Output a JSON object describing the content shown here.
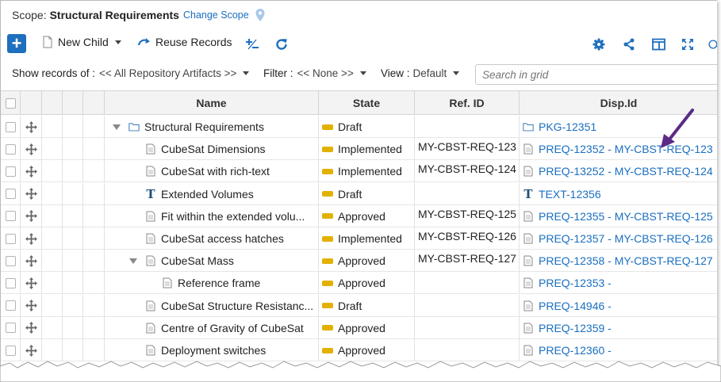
{
  "scope": {
    "label": "Scope:",
    "name": "Structural Requirements",
    "change": "Change Scope"
  },
  "toolbar": {
    "new_child": "New Child",
    "reuse": "Reuse Records",
    "icons": [
      "add-icon",
      "document-icon",
      "reuse-icon",
      "plus-minus-icon",
      "refresh-icon",
      "gear-icon",
      "share-icon",
      "columns-icon",
      "expand-icon"
    ]
  },
  "filterbar": {
    "show_label": "Show records of :",
    "show_value": "<< All Repository Artifacts >>",
    "filter_label": "Filter :",
    "filter_value": "<< None >>",
    "view_label": "View :",
    "view_value": "Default",
    "search_placeholder": "Search in grid"
  },
  "grid": {
    "columns": [
      "Name",
      "State",
      "Ref. ID",
      "Disp.Id"
    ],
    "rows": [
      {
        "name": "Structural Requirements",
        "icon": "folder",
        "indent": 0,
        "expander": true,
        "state": "Draft",
        "ref": "",
        "disp": "PKG-12351",
        "disp_icon": "folder"
      },
      {
        "name": "CubeSat Dimensions",
        "icon": "doc",
        "indent": 1,
        "expander": false,
        "state": "Implemented",
        "ref": "MY-CBST-REQ-123",
        "disp": "PREQ-12352 - MY-CBST-REQ-123",
        "disp_icon": "doc"
      },
      {
        "name": "CubeSat with rich-text",
        "icon": "doc",
        "indent": 1,
        "expander": false,
        "state": "Implemented",
        "ref": "MY-CBST-REQ-124",
        "disp": "PREQ-13252 - MY-CBST-REQ-124",
        "disp_icon": "doc"
      },
      {
        "name": "Extended Volumes",
        "icon": "text",
        "indent": 1,
        "expander": false,
        "state": "Draft",
        "ref": "",
        "disp": "TEXT-12356",
        "disp_icon": "text"
      },
      {
        "name": "Fit within the extended volu...",
        "icon": "doc",
        "indent": 1,
        "expander": false,
        "state": "Approved",
        "ref": "MY-CBST-REQ-125",
        "disp": "PREQ-12355 - MY-CBST-REQ-125",
        "disp_icon": "doc"
      },
      {
        "name": "CubeSat access hatches",
        "icon": "doc",
        "indent": 1,
        "expander": false,
        "state": "Implemented",
        "ref": "MY-CBST-REQ-126",
        "disp": "PREQ-12357 - MY-CBST-REQ-126",
        "disp_icon": "doc"
      },
      {
        "name": "CubeSat Mass",
        "icon": "doc",
        "indent": 1,
        "expander": true,
        "state": "Approved",
        "ref": "MY-CBST-REQ-127",
        "disp": "PREQ-12358 - MY-CBST-REQ-127",
        "disp_icon": "doc"
      },
      {
        "name": "Reference frame",
        "icon": "doc",
        "indent": 2,
        "expander": false,
        "state": "Approved",
        "ref": "",
        "disp": "PREQ-12353 -",
        "disp_icon": "doc"
      },
      {
        "name": "CubeSat Structure Resistanc...",
        "icon": "doc",
        "indent": 1,
        "expander": false,
        "state": "Draft",
        "ref": "",
        "disp": "PREQ-14946 -",
        "disp_icon": "doc"
      },
      {
        "name": "Centre of Gravity of CubeSat",
        "icon": "doc",
        "indent": 1,
        "expander": false,
        "state": "Approved",
        "ref": "",
        "disp": "PREQ-12359 -",
        "disp_icon": "doc"
      },
      {
        "name": "Deployment switches",
        "icon": "doc",
        "indent": 1,
        "expander": false,
        "state": "Approved",
        "ref": "",
        "disp": "PREQ-12360 -",
        "disp_icon": "doc"
      }
    ]
  },
  "colors": {
    "accent": "#1e6fbd",
    "link": "#1a6fc0",
    "state": "#e2b100",
    "arrow": "#5b2a86"
  }
}
